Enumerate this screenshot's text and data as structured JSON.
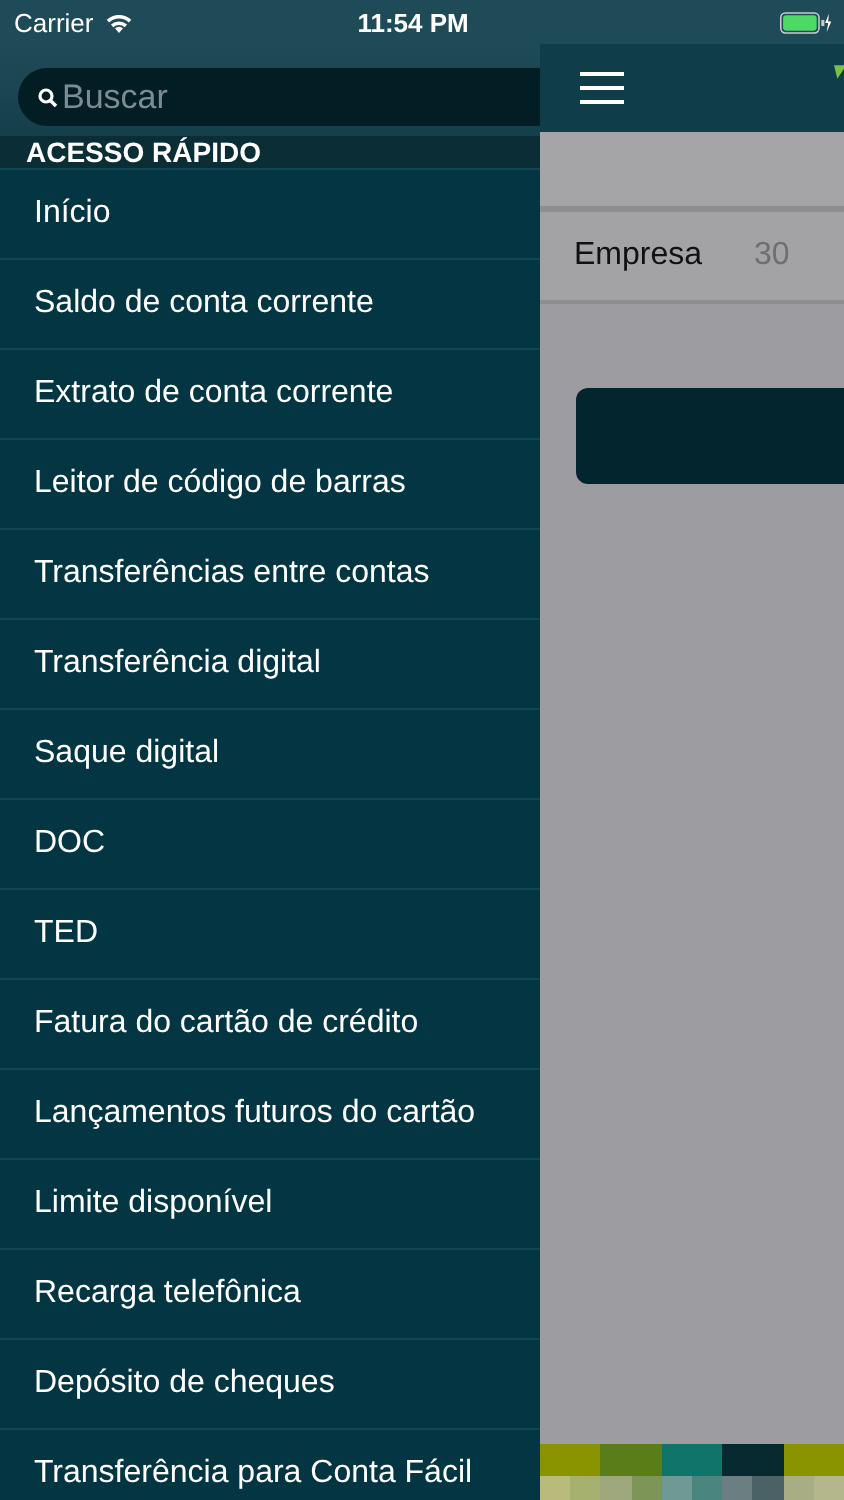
{
  "status_bar": {
    "carrier": "Carrier",
    "time": "11:54 PM"
  },
  "drawer": {
    "search": {
      "placeholder": "Buscar"
    },
    "section": "ACESSO RÁPIDO",
    "items": [
      {
        "label": "Início"
      },
      {
        "label": "Saldo de conta corrente"
      },
      {
        "label": "Extrato de conta corrente"
      },
      {
        "label": "Leitor de código de barras"
      },
      {
        "label": "Transferências entre contas"
      },
      {
        "label": "Transferência digital"
      },
      {
        "label": "Saque digital"
      },
      {
        "label": "DOC"
      },
      {
        "label": "TED"
      },
      {
        "label": "Fatura do cartão de crédito"
      },
      {
        "label": "Lançamentos futuros do cartão"
      },
      {
        "label": "Limite disponível"
      },
      {
        "label": "Recarga telefônica"
      },
      {
        "label": "Depósito de cheques"
      },
      {
        "label": "Transferência para Conta Fácil"
      }
    ]
  },
  "main": {
    "row": {
      "label": "Empresa",
      "value": "30"
    }
  }
}
